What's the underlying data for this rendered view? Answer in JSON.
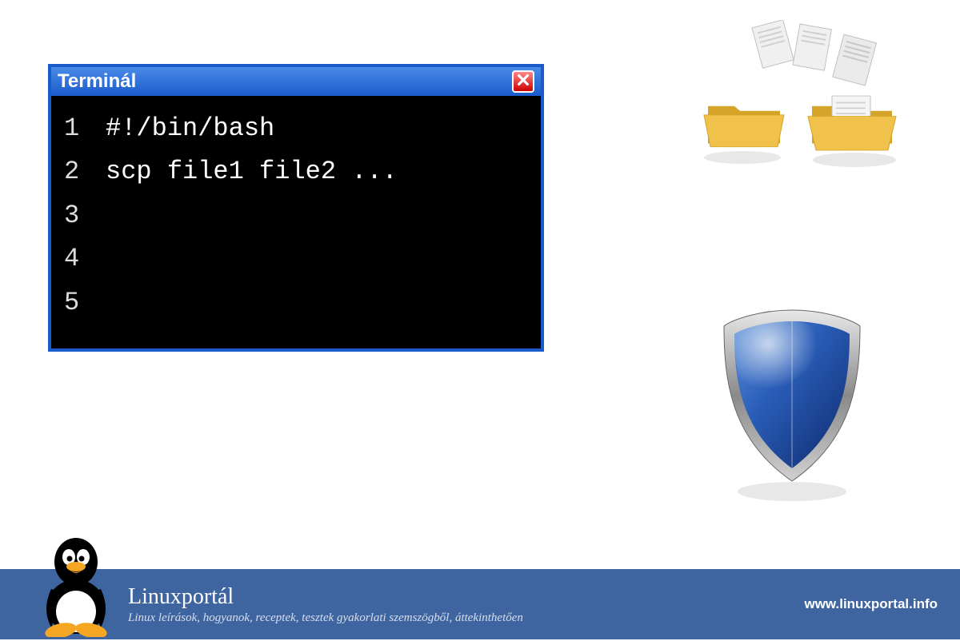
{
  "terminal": {
    "title": "Terminál",
    "lines": [
      {
        "num": "1",
        "content": "#!/bin/bash"
      },
      {
        "num": "2",
        "content": "scp file1 file2 ..."
      },
      {
        "num": "3",
        "content": ""
      },
      {
        "num": "4",
        "content": ""
      },
      {
        "num": "5",
        "content": ""
      }
    ]
  },
  "footer": {
    "title": "Linuxportál",
    "subtitle": "Linux leírások, hogyanok, receptek, tesztek gyakorlati szemszögből, áttekinthetően",
    "url": "www.linuxportal.info"
  }
}
